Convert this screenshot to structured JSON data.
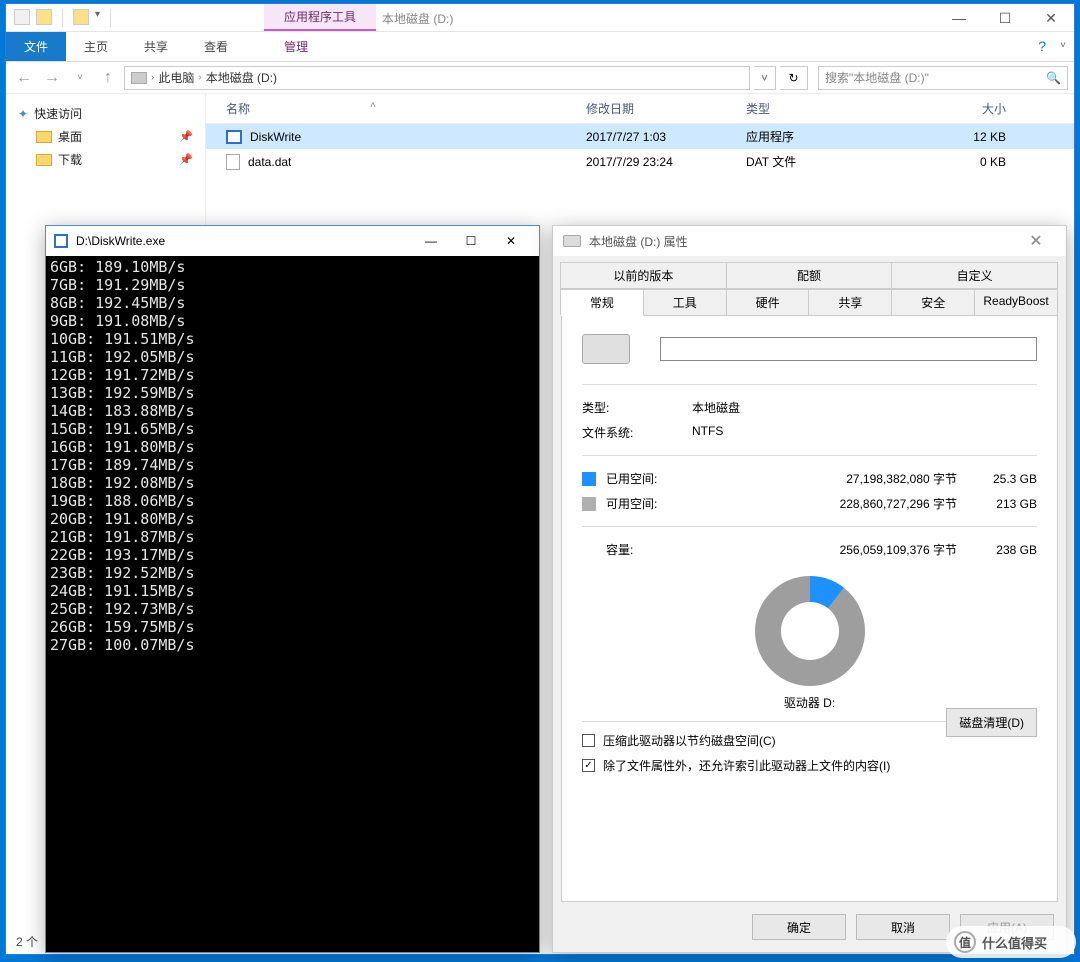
{
  "explorer": {
    "ctx_tab": "应用程序工具",
    "window_title": "本地磁盘 (D:)",
    "ribbon": {
      "file": "文件",
      "home": "主页",
      "share": "共享",
      "view": "查看",
      "manage": "管理"
    },
    "breadcrumb": {
      "pc": "此电脑",
      "drive": "本地磁盘 (D:)"
    },
    "search_placeholder": "搜索\"本地磁盘 (D:)\"",
    "cols": {
      "name": "名称",
      "date": "修改日期",
      "type": "类型",
      "size": "大小"
    },
    "files": [
      {
        "name": "DiskWrite",
        "date": "2017/7/27 1:03",
        "type": "应用程序",
        "size": "12 KB"
      },
      {
        "name": "data.dat",
        "date": "2017/7/29 23:24",
        "type": "DAT 文件",
        "size": "0 KB"
      }
    ],
    "tree": {
      "quick": "快速访问",
      "desktop": "桌面",
      "downloads": "下载"
    },
    "status": "2 个"
  },
  "console": {
    "title": "D:\\DiskWrite.exe",
    "lines": [
      "6GB: 189.10MB/s",
      "7GB: 191.29MB/s",
      "8GB: 192.45MB/s",
      "9GB: 191.08MB/s",
      "10GB: 191.51MB/s",
      "11GB: 192.05MB/s",
      "12GB: 191.72MB/s",
      "13GB: 192.59MB/s",
      "14GB: 183.88MB/s",
      "15GB: 191.65MB/s",
      "16GB: 191.80MB/s",
      "17GB: 189.74MB/s",
      "18GB: 192.08MB/s",
      "19GB: 188.06MB/s",
      "20GB: 191.80MB/s",
      "21GB: 191.87MB/s",
      "22GB: 193.17MB/s",
      "23GB: 192.52MB/s",
      "24GB: 191.15MB/s",
      "25GB: 192.73MB/s",
      "26GB: 159.75MB/s",
      "27GB: 100.07MB/s"
    ]
  },
  "props": {
    "title": "本地磁盘 (D:) 属性",
    "tabs_upper": [
      "以前的版本",
      "配额",
      "自定义"
    ],
    "tabs_lower": [
      "常规",
      "工具",
      "硬件",
      "共享",
      "安全",
      "ReadyBoost"
    ],
    "type_label": "类型:",
    "type_value": "本地磁盘",
    "fs_label": "文件系统:",
    "fs_value": "NTFS",
    "used_label": "已用空间:",
    "used_bytes": "27,198,382,080 字节",
    "used_hr": "25.3 GB",
    "free_label": "可用空间:",
    "free_bytes": "228,860,727,296 字节",
    "free_hr": "213 GB",
    "cap_label": "容量:",
    "cap_bytes": "256,059,109,376 字节",
    "cap_hr": "238 GB",
    "drive_label": "驱动器 D:",
    "clean": "磁盘清理(D)",
    "compress": "压缩此驱动器以节约磁盘空间(C)",
    "index": "除了文件属性外，还允许索引此驱动器上文件的内容(I)",
    "ok": "确定",
    "cancel": "取消",
    "apply": "应用(A)"
  },
  "watermark": "什么值得买"
}
